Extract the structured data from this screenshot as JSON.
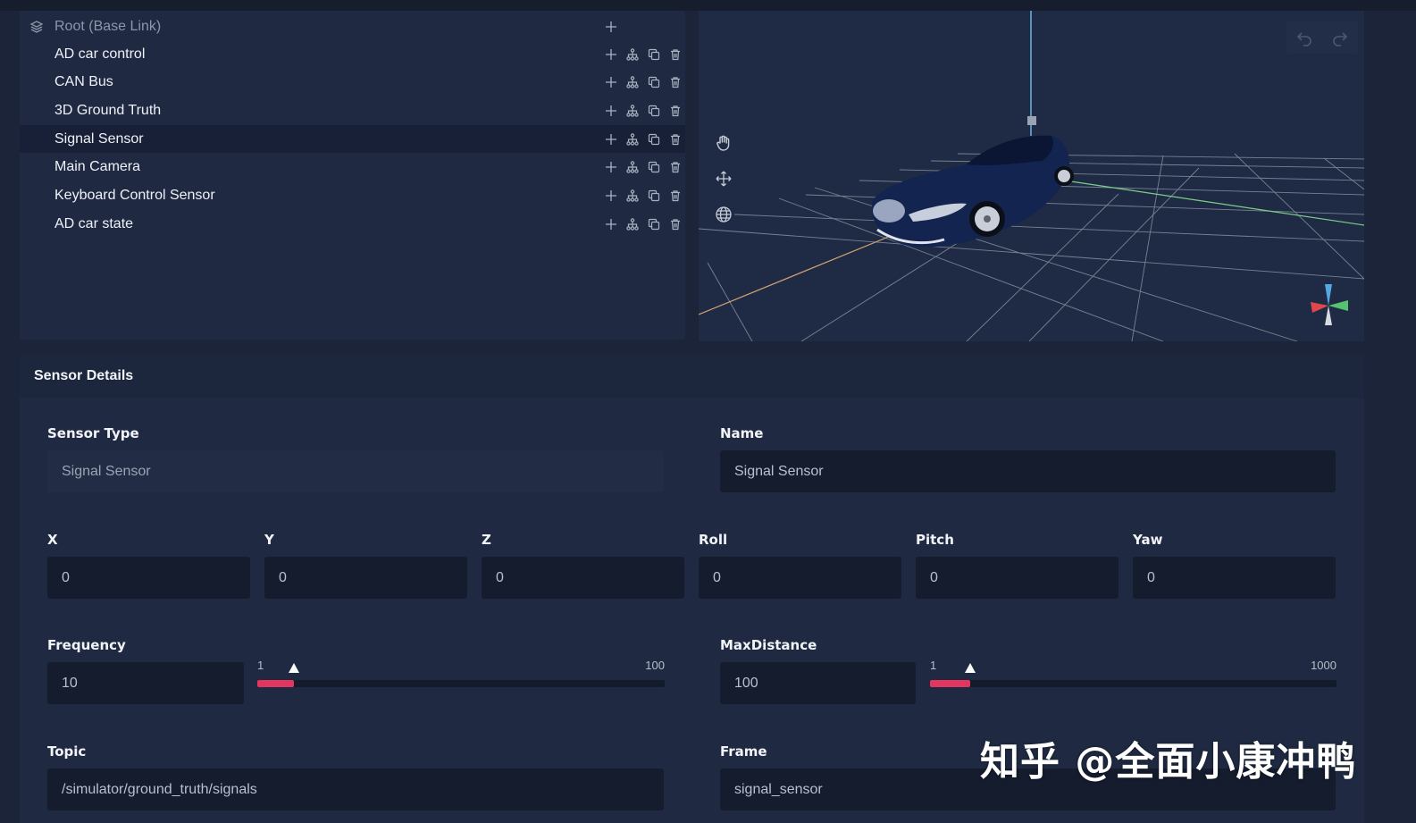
{
  "tree": {
    "root": {
      "label": "Root (Base Link)"
    },
    "items": [
      {
        "label": "AD car control",
        "selected": false
      },
      {
        "label": "CAN Bus",
        "selected": false
      },
      {
        "label": "3D Ground Truth",
        "selected": false
      },
      {
        "label": "Signal Sensor",
        "selected": true
      },
      {
        "label": "Main Camera",
        "selected": false
      },
      {
        "label": "Keyboard Control Sensor",
        "selected": false
      },
      {
        "label": "AD car state",
        "selected": false
      }
    ],
    "action_icons": [
      "plus-icon",
      "hierarchy-icon",
      "copy-icon",
      "trash-icon"
    ]
  },
  "viewport": {
    "tools": [
      "hand-icon",
      "move-icon",
      "globe-icon"
    ],
    "history": [
      "undo-icon",
      "redo-icon"
    ]
  },
  "details": {
    "title": "Sensor Details",
    "sensor_type": {
      "label": "Sensor Type",
      "value": "Signal Sensor"
    },
    "name": {
      "label": "Name",
      "value": "Signal Sensor"
    },
    "pose": [
      {
        "label": "X",
        "value": "0"
      },
      {
        "label": "Y",
        "value": "0"
      },
      {
        "label": "Z",
        "value": "0"
      },
      {
        "label": "Roll",
        "value": "0"
      },
      {
        "label": "Pitch",
        "value": "0"
      },
      {
        "label": "Yaw",
        "value": "0"
      }
    ],
    "frequency": {
      "label": "Frequency",
      "value": "10",
      "min": "1",
      "max": "100",
      "slider_value": 10
    },
    "max_distance": {
      "label": "MaxDistance",
      "value": "100",
      "min": "1",
      "max": "1000",
      "slider_value": 100
    },
    "topic": {
      "label": "Topic",
      "value": "/simulator/ground_truth/signals"
    },
    "frame": {
      "label": "Frame",
      "value": "signal_sensor"
    }
  },
  "colors": {
    "accent": "#e0365f",
    "panel": "#1f2a42",
    "input": "#141c2e"
  },
  "watermark": "知乎 @全面小康冲鸭"
}
